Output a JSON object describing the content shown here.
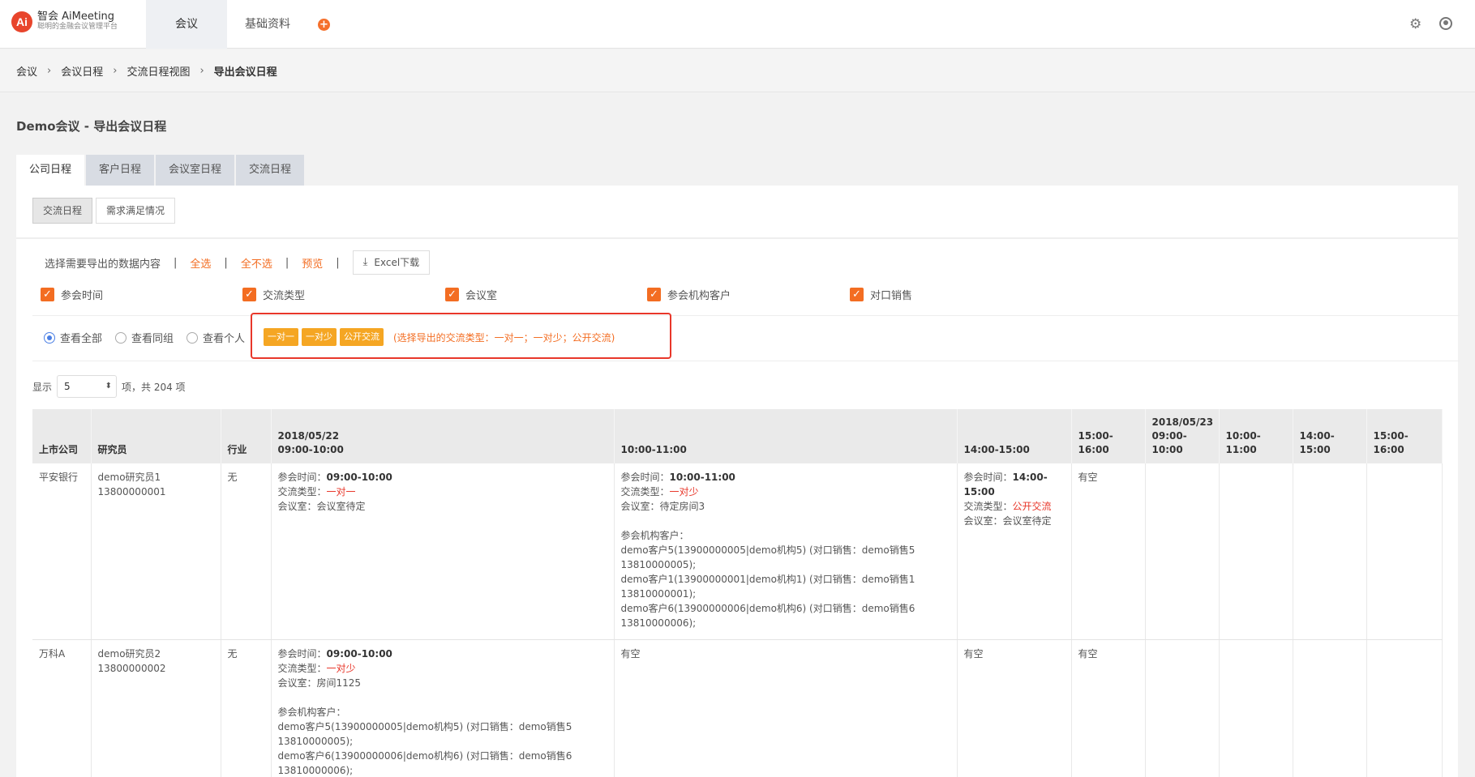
{
  "app": {
    "logo_mark": "Ai",
    "logo_title": "智会 AiMeeting",
    "logo_sub": "聪明的金融会议管理平台"
  },
  "nav": {
    "meetings": "会议",
    "basic": "基础资料",
    "plus": "+"
  },
  "breadcrumb": [
    "会议",
    "会议日程",
    "交流日程视图",
    "导出会议日程"
  ],
  "page_title": "Demo会议 - 导出会议日程",
  "tabs": [
    "公司日程",
    "客户日程",
    "会议室日程",
    "交流日程"
  ],
  "subtabs": [
    "交流日程",
    "需求满足情况"
  ],
  "toolbar": {
    "label": "选择需要导出的数据内容",
    "select_all": "全选",
    "select_none": "全不选",
    "preview": "预览",
    "excel": "Excel下载"
  },
  "checks": [
    "参会时间",
    "交流类型",
    "会议室",
    "参会机构客户",
    "对口销售"
  ],
  "radios": [
    "查看全部",
    "查看同组",
    "查看个人"
  ],
  "types": [
    "一对一",
    "一对少",
    "公开交流"
  ],
  "type_note": "(选择导出的交流类型：一对一；一对少；公开交流)",
  "show": {
    "prefix": "显示",
    "value": "5",
    "suffix": "项，共 204 项"
  },
  "table": {
    "headers": {
      "company": "上市公司",
      "researcher": "研究员",
      "industry": "行业",
      "date1": "2018/05/22",
      "slot1": "09:00-10:00",
      "slot2": "10:00-11:00",
      "slot3": "14:00-15:00",
      "slot4": "15:00-16:00",
      "date2": "2018/05/23",
      "slot5": "09:00-10:00",
      "slot6": "10:00-11:00",
      "slot7": "14:00-15:00",
      "slot8": "15:00-16:00"
    },
    "labels": {
      "time": "参会时间：",
      "type": "交流类型：",
      "room": "会议室：",
      "clients": "参会机构客户：",
      "free": "有空"
    },
    "rows": [
      {
        "company": "平安银行",
        "researcher": "demo研究员1",
        "phone": "13800000001",
        "industry": "无",
        "c1": {
          "time": "09:00-10:00",
          "type": "一对一",
          "room": "会议室待定"
        },
        "c2": {
          "time": "10:00-11:00",
          "type": "一对少",
          "room": "待定房间3",
          "clients": [
            "demo客户5(13900000005|demo机构5) (对口销售：demo销售5",
            "13810000005);",
            "demo客户1(13900000001|demo机构1) (对口销售：demo销售1",
            "13810000001);",
            "demo客户6(13900000006|demo机构6) (对口销售：demo销售6",
            "13810000006);"
          ]
        },
        "c3": {
          "time_a": "14:00-",
          "time_b": "15:00",
          "type": "公开交流",
          "room": "会议室待定"
        },
        "c4": "有空"
      },
      {
        "company": "万科A",
        "researcher": "demo研究员2",
        "phone": "13800000002",
        "industry": "无",
        "c1": {
          "time": "09:00-10:00",
          "type": "一对少",
          "room": "房间1125",
          "clients": [
            "demo客户5(13900000005|demo机构5) (对口销售：demo销售5",
            "13810000005);",
            "demo客户6(13900000006|demo机构6) (对口销售：demo销售6",
            "13810000006);"
          ]
        },
        "c2": "有空",
        "c3": "有空",
        "c4": "有空"
      }
    ]
  },
  "colors": {
    "accent": "#f36d22",
    "highlight": "#e8372a",
    "type_button": "#f5a623"
  }
}
